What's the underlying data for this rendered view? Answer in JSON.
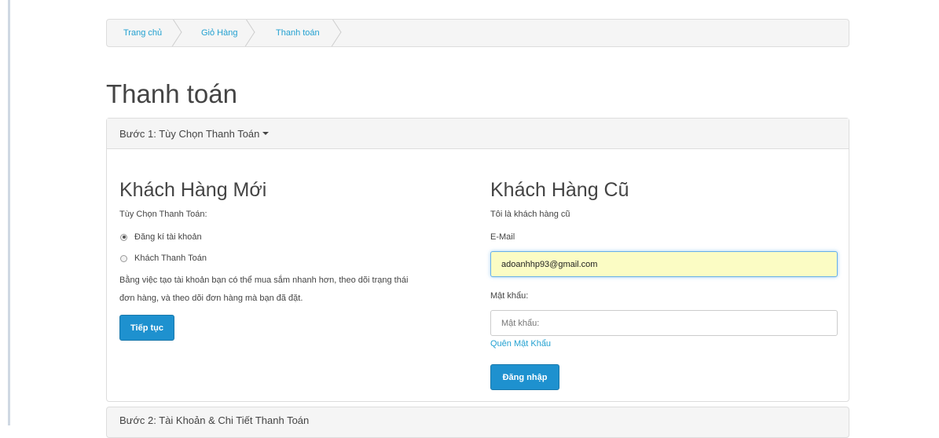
{
  "breadcrumb": {
    "items": [
      {
        "label": "Trang chủ"
      },
      {
        "label": "Giỏ Hàng"
      },
      {
        "label": "Thanh toán"
      }
    ]
  },
  "page": {
    "title": "Thanh toán"
  },
  "step1": {
    "heading": "Bước 1: Tùy Chọn Thanh Toán",
    "new_customer": {
      "title": "Khách Hàng Mới",
      "subtitle": "Tùy Chọn Thanh Toán:",
      "options": [
        {
          "label": "Đăng kí tài khoản",
          "selected": true
        },
        {
          "label": "Khách Thanh Toán",
          "selected": false
        }
      ],
      "description_line1": "Bằng việc tạo tài khoản bạn có thể mua sắm nhanh hơn, theo dõi trạng thái",
      "description_line2": "đơn hàng, và theo dõi đơn hàng mà bạn đã đặt.",
      "continue_label": "Tiếp tục"
    },
    "returning_customer": {
      "title": "Khách Hàng Cũ",
      "subtitle": "Tôi là khách hàng cũ",
      "email_label": "E-Mail",
      "email_value": "adoanhhp93@gmail.com",
      "password_label": "Mật khẩu:",
      "password_placeholder": "Mật khẩu:",
      "forgot_label": "Quên Mật Khẩu",
      "login_label": "Đăng nhập"
    }
  },
  "step2": {
    "heading": "Bước 2: Tài Khoản & Chi Tiết Thanh Toán"
  }
}
